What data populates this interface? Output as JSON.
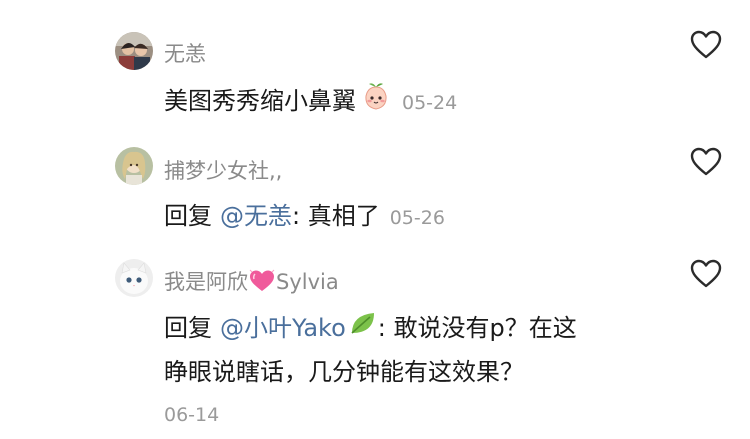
{
  "comments": [
    {
      "username": "无恙",
      "text": "美图秀秀缩小鼻翼",
      "emoji": "peach-face-emoji",
      "date": "05-24"
    },
    {
      "username": "捕梦少女社,,",
      "reply_prefix": "回复",
      "mention": "@无恙",
      "text": ": 真相了",
      "date": "05-26"
    },
    {
      "username_prefix": "我是阿欣",
      "username_suffix": "Sylvia",
      "username_emoji": "pink-heart-emoji",
      "reply_prefix": "回复",
      "mention": "@小叶Yako",
      "mention_emoji": "leaf-emoji",
      "line1": ": 敢说没有p？在这",
      "line2": "睁眼说瞎话，几分钟能有这效果？",
      "date": "06-14"
    }
  ],
  "colors": {
    "username": "#8a8a8a",
    "text": "#1a1a1a",
    "mention": "#4a6f9c",
    "date": "#9a9a9a"
  }
}
